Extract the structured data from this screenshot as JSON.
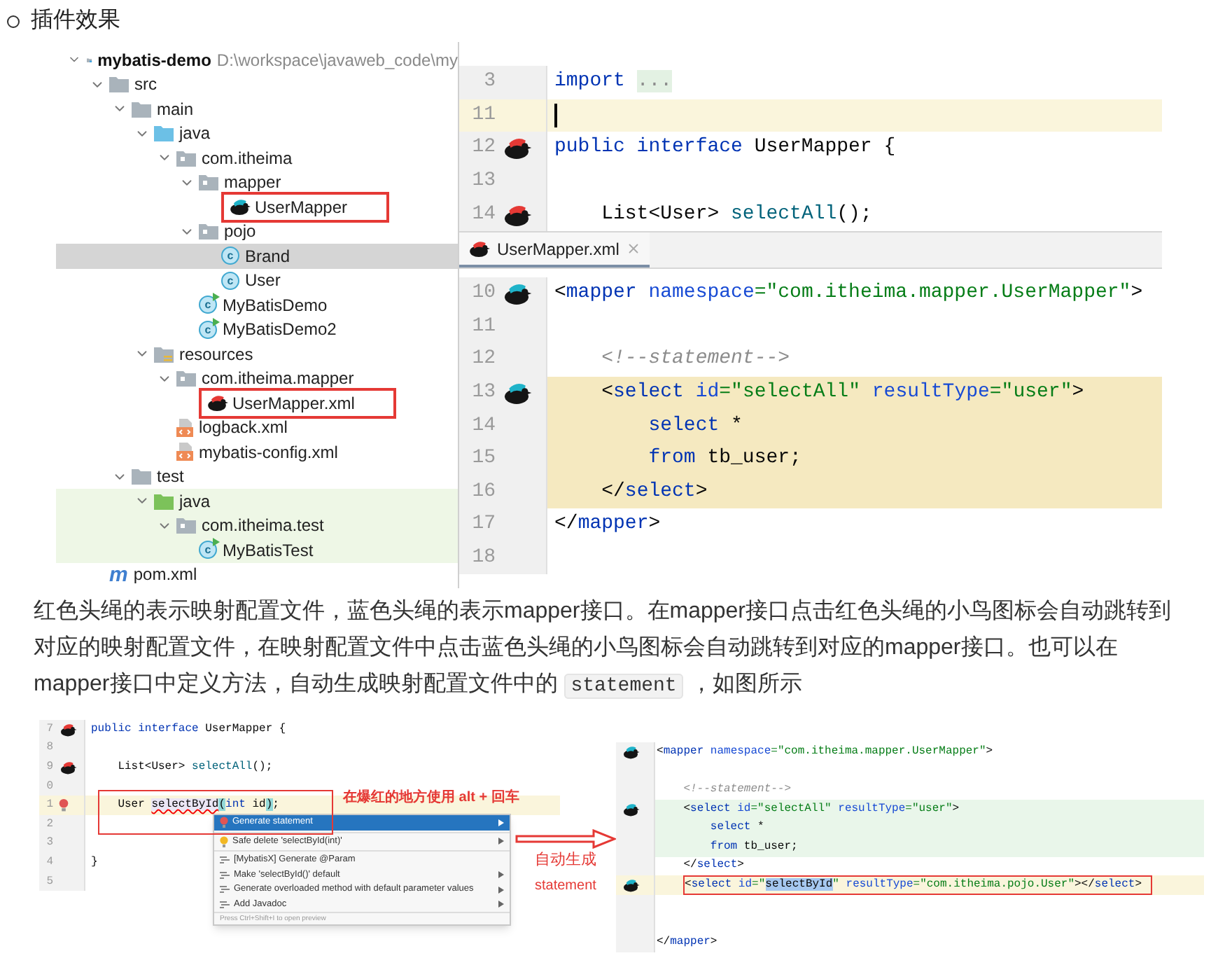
{
  "section_heading": "插件效果",
  "project_view": {
    "root": {
      "name": "mybatis-demo",
      "path": "D:\\workspace\\javaweb_code\\my",
      "expanded": true
    },
    "items": [
      {
        "name": "src",
        "kind": "folder",
        "expanded": true,
        "selected": false,
        "boxed": false,
        "in_test": false,
        "children": [
          {
            "name": "main",
            "kind": "folder",
            "expanded": true,
            "selected": false,
            "boxed": false,
            "in_test": false,
            "children": [
              {
                "name": "java",
                "kind": "source-folder",
                "expanded": true,
                "selected": false,
                "boxed": false,
                "in_test": false,
                "children": [
                  {
                    "name": "com.itheima",
                    "kind": "package",
                    "expanded": true,
                    "selected": false,
                    "boxed": false,
                    "in_test": false,
                    "children": [
                      {
                        "name": "mapper",
                        "kind": "package",
                        "expanded": true,
                        "selected": false,
                        "boxed": false,
                        "in_test": false,
                        "children": [
                          {
                            "name": "UserMapper",
                            "kind": "mapper-interface",
                            "selected": false,
                            "boxed": true,
                            "in_test": false
                          }
                        ]
                      },
                      {
                        "name": "pojo",
                        "kind": "package",
                        "expanded": true,
                        "selected": false,
                        "boxed": false,
                        "in_test": false,
                        "children": [
                          {
                            "name": "Brand",
                            "kind": "class",
                            "glyph": "c",
                            "selected": true,
                            "boxed": false,
                            "in_test": false
                          },
                          {
                            "name": "User",
                            "kind": "class",
                            "glyph": "c",
                            "selected": false,
                            "boxed": false,
                            "in_test": false
                          }
                        ]
                      },
                      {
                        "name": "MyBatisDemo",
                        "kind": "runnable-class",
                        "glyph": "c",
                        "selected": false,
                        "boxed": false,
                        "in_test": false
                      },
                      {
                        "name": "MyBatisDemo2",
                        "kind": "runnable-class",
                        "glyph": "c",
                        "selected": false,
                        "boxed": false,
                        "in_test": false
                      }
                    ]
                  }
                ]
              },
              {
                "name": "resources",
                "kind": "resources-folder",
                "expanded": true,
                "selected": false,
                "boxed": false,
                "in_test": false,
                "children": [
                  {
                    "name": "com.itheima.mapper",
                    "kind": "package",
                    "expanded": true,
                    "selected": false,
                    "boxed": false,
                    "in_test": false,
                    "children": [
                      {
                        "name": "UserMapper.xml",
                        "kind": "mapper-xml",
                        "selected": false,
                        "boxed": true,
                        "in_test": false
                      }
                    ]
                  },
                  {
                    "name": "logback.xml",
                    "kind": "xml",
                    "selected": false,
                    "boxed": false,
                    "in_test": false
                  },
                  {
                    "name": "mybatis-config.xml",
                    "kind": "xml",
                    "selected": false,
                    "boxed": false,
                    "in_test": false
                  }
                ]
              }
            ]
          },
          {
            "name": "test",
            "kind": "folder",
            "expanded": true,
            "selected": false,
            "boxed": false,
            "in_test": false,
            "children": [
              {
                "name": "java",
                "kind": "test-folder",
                "expanded": true,
                "selected": false,
                "boxed": false,
                "in_test": true,
                "children": [
                  {
                    "name": "com.itheima.test",
                    "kind": "package",
                    "expanded": true,
                    "selected": false,
                    "boxed": false,
                    "in_test": true,
                    "children": [
                      {
                        "name": "MyBatisTest",
                        "kind": "runnable-class",
                        "glyph": "c",
                        "selected": false,
                        "boxed": false,
                        "in_test": true
                      }
                    ]
                  }
                ]
              }
            ]
          }
        ]
      },
      {
        "name": "pom.xml",
        "kind": "maven",
        "glyph": "m",
        "selected": false,
        "boxed": false,
        "in_test": false
      }
    ]
  },
  "java_editor": {
    "lines": [
      {
        "number": "3",
        "kind": "plain",
        "current": false,
        "caret": false,
        "segments": [
          {
            "text": "import ",
            "kind": "kw"
          },
          {
            "text": "...",
            "kind": "dim"
          }
        ]
      },
      {
        "number": "11",
        "kind": "plain",
        "current": true,
        "caret": true
      },
      {
        "number": "12",
        "kind": "red-bird",
        "current": false,
        "caret": false,
        "segments": [
          {
            "text": "public interface",
            "kind": "kw"
          },
          {
            "text": " UserMapper {",
            "kind": "plain"
          }
        ]
      },
      {
        "number": "13",
        "kind": "plain",
        "current": false,
        "caret": false
      },
      {
        "number": "14",
        "kind": "red-bird",
        "current": false,
        "caret": false,
        "segments": [
          {
            "text": "    List<User> ",
            "kind": "plain"
          },
          {
            "text": "selectAll",
            "kind": "method"
          },
          {
            "text": "();",
            "kind": "plain"
          }
        ]
      }
    ]
  },
  "xml_tab": {
    "label": "UserMapper.xml",
    "selected": true
  },
  "xml_editor": {
    "lines": [
      {
        "number": "10",
        "kind": "blue-bird",
        "current": false,
        "injected": false,
        "segments": [
          {
            "text": "<",
            "kind": "plain"
          },
          {
            "text": "mapper",
            "kind": "tag"
          },
          {
            "text": " namespace",
            "kind": "attr"
          },
          {
            "text": "=\"com.itheima.mapper.UserMapper\"",
            "kind": "str"
          },
          {
            "text": ">",
            "kind": "plain"
          }
        ]
      },
      {
        "number": "11",
        "kind": "plain",
        "current": false,
        "injected": false
      },
      {
        "number": "12",
        "kind": "plain",
        "current": false,
        "injected": false,
        "segments": [
          {
            "text": "    <!--statement-->",
            "kind": "comment"
          }
        ]
      },
      {
        "number": "13",
        "kind": "blue-bird",
        "current": false,
        "injected": true,
        "segments": [
          {
            "text": "    <",
            "kind": "plain"
          },
          {
            "text": "select",
            "kind": "tag"
          },
          {
            "text": " id",
            "kind": "attr"
          },
          {
            "text": "=\"selectAll\"",
            "kind": "str"
          },
          {
            "text": " resultType",
            "kind": "attr"
          },
          {
            "text": "=\"user\"",
            "kind": "str"
          },
          {
            "text": ">",
            "kind": "plain"
          }
        ]
      },
      {
        "number": "14",
        "kind": "plain",
        "current": false,
        "injected": true,
        "segments": [
          {
            "text": "        select",
            "kind": "sql"
          },
          {
            "text": " *",
            "kind": "plain"
          }
        ]
      },
      {
        "number": "15",
        "kind": "plain",
        "current": false,
        "injected": true,
        "segments": [
          {
            "text": "        from",
            "kind": "sql"
          },
          {
            "text": " tb_user;",
            "kind": "plain"
          }
        ]
      },
      {
        "number": "16",
        "kind": "plain",
        "current": false,
        "injected": true,
        "segments": [
          {
            "text": "    </",
            "kind": "plain"
          },
          {
            "text": "select",
            "kind": "tag"
          },
          {
            "text": ">",
            "kind": "plain"
          }
        ]
      },
      {
        "number": "17",
        "kind": "plain",
        "current": false,
        "injected": false,
        "segments": [
          {
            "text": "</",
            "kind": "plain"
          },
          {
            "text": "mapper",
            "kind": "tag"
          },
          {
            "text": ">",
            "kind": "plain"
          }
        ]
      },
      {
        "number": "18",
        "kind": "plain",
        "current": false,
        "injected": false
      }
    ]
  },
  "paragraph": [
    {
      "text": "红色头绳的表示映射配置文件，蓝色头绳的表示mapper接口。在mapper接口点击红色头绳的小鸟图标会自动跳转到对应的映射配置文件，在映射配置文件中点击蓝色头绳的小鸟图标会自动跳转到对应的mapper接口。也可以在mapper接口中定义方法，自动生成映射配置文件中的 ",
      "kind": "text"
    },
    {
      "text": "statement",
      "kind": "code"
    },
    {
      "text": " ，如图所示",
      "kind": "text"
    }
  ],
  "example_java": {
    "lines": [
      {
        "number": "7",
        "kind": "red-bird",
        "current": false,
        "segments": [
          {
            "text": "public interface",
            "kind": "kw"
          },
          {
            "text": " UserMapper {",
            "kind": "plain"
          }
        ]
      },
      {
        "number": "8",
        "kind": "plain",
        "current": false
      },
      {
        "number": "9",
        "kind": "red-bird",
        "current": false,
        "segments": [
          {
            "text": "    List<User> ",
            "kind": "plain"
          },
          {
            "text": "selectAll",
            "kind": "method"
          },
          {
            "text": "();",
            "kind": "plain"
          }
        ]
      },
      {
        "number": "0",
        "kind": "plain",
        "current": false
      },
      {
        "number": "1",
        "kind": "error-bulb",
        "current": true,
        "segments": [
          {
            "text": "    User ",
            "kind": "plain"
          },
          {
            "text": "selectById",
            "kind": "error"
          },
          {
            "text": "(",
            "kind": "brace"
          },
          {
            "text": "int",
            "kind": "kw"
          },
          {
            "text": " id",
            "kind": "plain"
          },
          {
            "text": ")",
            "kind": "brace"
          },
          {
            "text": ";",
            "kind": "plain"
          }
        ]
      },
      {
        "number": "2",
        "kind": "plain",
        "current": false
      },
      {
        "number": "3",
        "kind": "plain",
        "current": false
      },
      {
        "number": "4",
        "kind": "plain",
        "current": false,
        "segments": [
          {
            "text": "}",
            "kind": "plain"
          }
        ]
      },
      {
        "number": "5",
        "kind": "plain",
        "current": false
      }
    ],
    "annotation": "在爆红的地方使用 alt + 回车",
    "menu": {
      "items": [
        {
          "label": "Generate statement",
          "kind": "error-bulb",
          "selected": true,
          "submenu": true,
          "separated": false
        },
        {
          "label": "Safe delete 'selectById(int)'",
          "kind": "bulb",
          "selected": false,
          "submenu": true,
          "separated": true
        },
        {
          "label": "[MybatisX] Generate @Param",
          "kind": "intention",
          "selected": false,
          "submenu": false,
          "separated": true
        },
        {
          "label": "Make 'selectById()' default",
          "kind": "intention",
          "selected": false,
          "submenu": true,
          "separated": false
        },
        {
          "label": "Generate overloaded method with default parameter values",
          "kind": "intention",
          "selected": false,
          "submenu": true,
          "separated": false
        },
        {
          "label": "Add Javadoc",
          "kind": "intention",
          "selected": false,
          "submenu": true,
          "separated": false
        }
      ],
      "footer": "Press Ctrl+Shift+I to open preview"
    }
  },
  "arrow_labels": [
    "自动生成",
    "statement"
  ],
  "example_xml": {
    "lines": [
      {
        "kind": "blue-bird",
        "current": false,
        "injected": false,
        "boxed": false,
        "segments": [
          {
            "text": "<",
            "kind": "plain"
          },
          {
            "text": "mapper",
            "kind": "tag"
          },
          {
            "text": " namespace",
            "kind": "attr"
          },
          {
            "text": "=\"com.itheima.mapper.UserMapper\"",
            "kind": "str"
          },
          {
            "text": ">",
            "kind": "plain"
          }
        ]
      },
      {
        "kind": "plain",
        "current": false,
        "injected": false,
        "boxed": false
      },
      {
        "kind": "plain",
        "current": false,
        "injected": false,
        "boxed": false,
        "segments": [
          {
            "text": "    <!--statement-->",
            "kind": "comment"
          }
        ]
      },
      {
        "kind": "blue-bird",
        "current": false,
        "injected": true,
        "boxed": false,
        "segments": [
          {
            "text": "    <",
            "kind": "plain"
          },
          {
            "text": "select",
            "kind": "tag"
          },
          {
            "text": " id",
            "kind": "attr"
          },
          {
            "text": "=\"selectAll\"",
            "kind": "str"
          },
          {
            "text": " resultType",
            "kind": "attr"
          },
          {
            "text": "=\"user\"",
            "kind": "str"
          },
          {
            "text": ">",
            "kind": "plain"
          }
        ]
      },
      {
        "kind": "plain",
        "current": false,
        "injected": true,
        "boxed": false,
        "segments": [
          {
            "text": "        select",
            "kind": "sql"
          },
          {
            "text": " *",
            "kind": "plain"
          }
        ]
      },
      {
        "kind": "plain",
        "current": false,
        "injected": true,
        "boxed": false,
        "segments": [
          {
            "text": "        from",
            "kind": "sql"
          },
          {
            "text": " tb_user;",
            "kind": "plain"
          }
        ]
      },
      {
        "kind": "plain",
        "current": false,
        "injected": false,
        "boxed": false,
        "segments": [
          {
            "text": "    </",
            "kind": "plain"
          },
          {
            "text": "select",
            "kind": "tag"
          },
          {
            "text": ">",
            "kind": "plain"
          }
        ]
      },
      {
        "kind": "blue-bird",
        "current": true,
        "injected": false,
        "boxed": true,
        "segments": [
          {
            "text": "<",
            "kind": "plain"
          },
          {
            "text": "select",
            "kind": "tag"
          },
          {
            "text": " id",
            "kind": "attr"
          },
          {
            "text": "=\"",
            "kind": "str"
          },
          {
            "text": "selectById",
            "kind": "sel"
          },
          {
            "text": "\"",
            "kind": "str"
          },
          {
            "text": " resultType",
            "kind": "attr"
          },
          {
            "text": "=\"com.itheima.pojo.User\"",
            "kind": "str"
          },
          {
            "text": "></",
            "kind": "plain"
          },
          {
            "text": "select",
            "kind": "tag"
          },
          {
            "text": ">",
            "kind": "plain"
          }
        ]
      },
      {
        "kind": "plain",
        "current": false,
        "injected": false,
        "boxed": false
      },
      {
        "kind": "plain",
        "current": false,
        "injected": false,
        "boxed": false
      },
      {
        "kind": "plain",
        "current": false,
        "injected": false,
        "boxed": false,
        "segments": [
          {
            "text": "</",
            "kind": "plain"
          },
          {
            "text": "mapper",
            "kind": "tag"
          },
          {
            "text": ">",
            "kind": "plain"
          }
        ]
      }
    ]
  }
}
